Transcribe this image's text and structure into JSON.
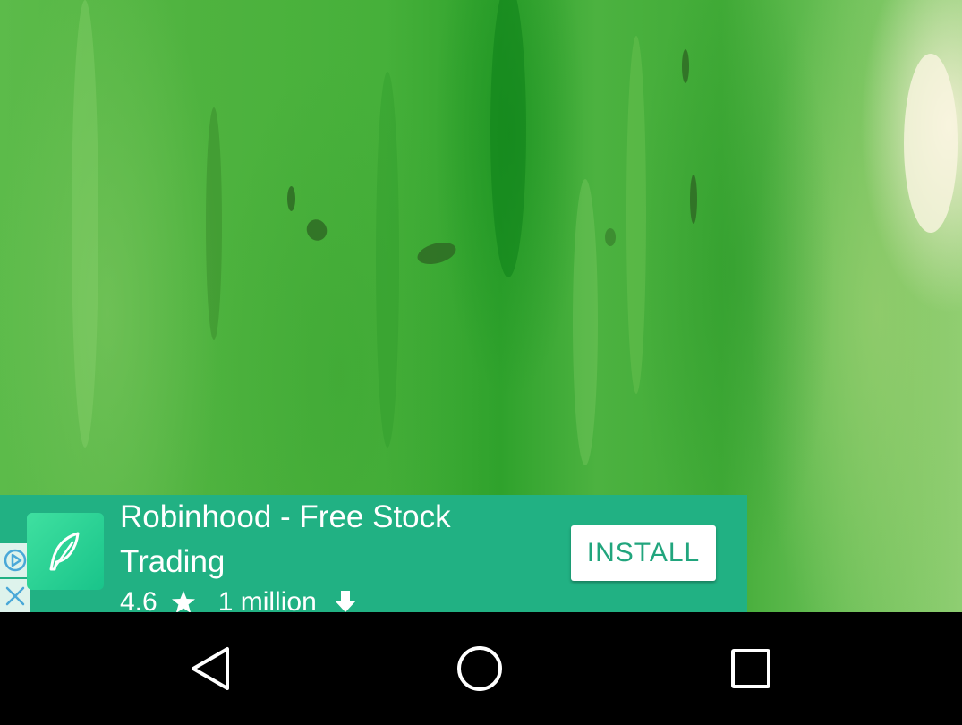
{
  "ad": {
    "title": "Robinhood - Free Stock Trading",
    "rating": "4.6",
    "rating_icon": "star-icon",
    "downloads": "1 million",
    "downloads_icon": "download-arrow-icon",
    "install_label": "INSTALL",
    "app_icon": "feather-icon",
    "adchoices_icon": "adchoices-icon",
    "close_icon": "close-icon",
    "background_color": "#21b183"
  },
  "navigation": {
    "back_icon": "back-triangle-icon",
    "home_icon": "home-circle-icon",
    "recents_icon": "recents-square-icon"
  }
}
